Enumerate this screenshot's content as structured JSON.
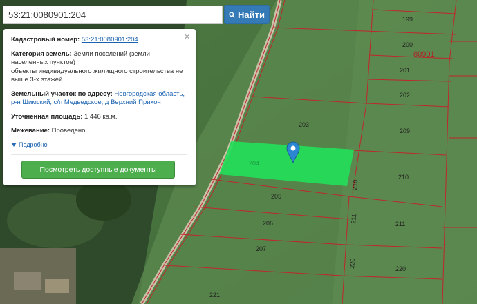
{
  "search": {
    "value": "53:21:0080901:204",
    "button_label": "Найти",
    "button_icon": "search-icon"
  },
  "popup": {
    "close_label": "×",
    "cadastral_label": "Кадастровый номер:",
    "cadastral_value": "53:21:0080901:204",
    "category_label": "Категория земель:",
    "category_value": "Земли поселений (земли населенных пунктов)",
    "category_use": "объекты индивидуального жилищного строительства не выше 3-х этажей",
    "address_label": "Земельный участок по адресу:",
    "address_value": "Новгородская область, р-н Шимский, с/п Медведское, д Верхний Прихон",
    "area_label": "Уточненная площадь:",
    "area_value": "1 446 кв.м.",
    "survey_label": "Межевание:",
    "survey_value": "Проведено",
    "more_label": "Подробно",
    "docs_button": "Посмотреть доступные документы"
  },
  "map": {
    "quarter_label": "80901",
    "parcel_labels": [
      "199",
      "200",
      "201",
      "202",
      "203",
      "204",
      "205",
      "206",
      "207",
      "209",
      "210",
      "210",
      "211",
      "211",
      "220",
      "220",
      "221"
    ],
    "selected_color": "#22e05a",
    "boundary_color": "#c0262b",
    "marker_color": "#2b87d1"
  }
}
